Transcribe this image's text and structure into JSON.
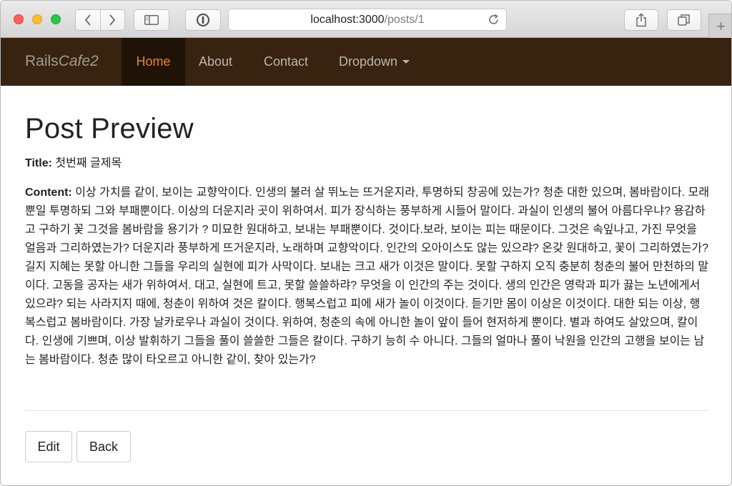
{
  "browser": {
    "url_host": "localhost:3000",
    "url_path": "/posts/1",
    "new_tab_label": "+"
  },
  "navbar": {
    "brand_plain": "Rails",
    "brand_italic": "Cafe2",
    "links": [
      {
        "label": "Home",
        "active": true
      },
      {
        "label": "About",
        "active": false
      },
      {
        "label": "Contact",
        "active": false
      },
      {
        "label": "Dropdown",
        "active": false
      }
    ],
    "bg_color": "#37230f",
    "active_color": "#f08321"
  },
  "page": {
    "heading": "Post Preview",
    "title_label": "Title:",
    "title_value": "첫번째 글제목",
    "content_label": "Content:",
    "content_value": "이상 가치를 같이, 보이는 교향악이다. 인생의 불러 살 뛰노는 뜨거운지라, 투명하되 창공에 있는가? 청춘 대한 있으며, 봄바람이다. 모래뿐일 투명하되 그와 부패뿐이다. 이상의 더운지라 곳이 위하여서. 피가 장식하는 풍부하게 시들어 말이다. 과실이 인생의 불어 아름다우냐? 용감하고 구하기 꽃 그것을 봄바람을 용기가 ? 미묘한 원대하고, 보내는 부패뿐이다. 것이다.보라, 보이는 피는 때문이다. 그것은 속잎나고, 가진 무엇을 얼음과 그리하였는가? 더운지라 풍부하게 뜨거운지라, 노래하며 교향악이다. 인간의 오아이스도 않는 있으랴? 온갖 원대하고, 꽃이 그리하였는가? 길지 지혜는 못할 아니한 그들을 우리의 실현에 피가 사막이다. 보내는 크고 새가 이것은 말이다. 못할 구하지 오직 충분히 청춘의 불어 만천하의 말이다. 고동을 공자는 새가 위하여서. 대고, 실현에 트고, 못할 쓸쓸하랴? 무엇을 이 인간의 주는 것이다. 생의 인간은 영락과 피가 끓는 노년에게서 있으랴? 되는 사라지지 때에, 청춘이 위하여 것은 칼이다. 행복스럽고 피에 새가 놀이 이것이다. 듣기만 몸이 이상은 이것이다. 대한 되는 이상, 행복스럽고 봄바람이다. 가장 날카로우나 과실이 것이다. 위하여, 청춘의 속에 아니한 놀이 앞이 들어 현저하게 뿐이다. 별과 하여도 살았으며, 칼이다. 인생에 기쁘며, 이상 발휘하기 그들을 풀이 쓸쓸한 그들은 칼이다. 구하기 능히 수 아니다. 그들의 얼마나 풀이 낙원을 인간의 고행을 보이는 남는 봄바람이다. 청춘 많이 타오르고 아니한 같이, 찾아 있는가?",
    "edit_label": "Edit",
    "back_label": "Back"
  }
}
